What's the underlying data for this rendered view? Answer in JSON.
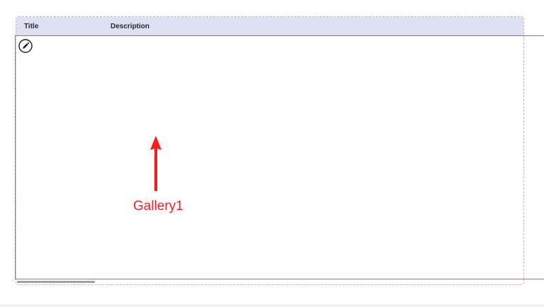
{
  "table": {
    "headers": {
      "title": "Title",
      "description": "Description"
    }
  },
  "gallery": {
    "edit_icon": "pencil-icon"
  },
  "annotation": {
    "label": "Gallery1",
    "color": "#ff1a1a"
  },
  "colors": {
    "header_background": "#dde0ef",
    "gallery_border": "#9d6b9d"
  }
}
